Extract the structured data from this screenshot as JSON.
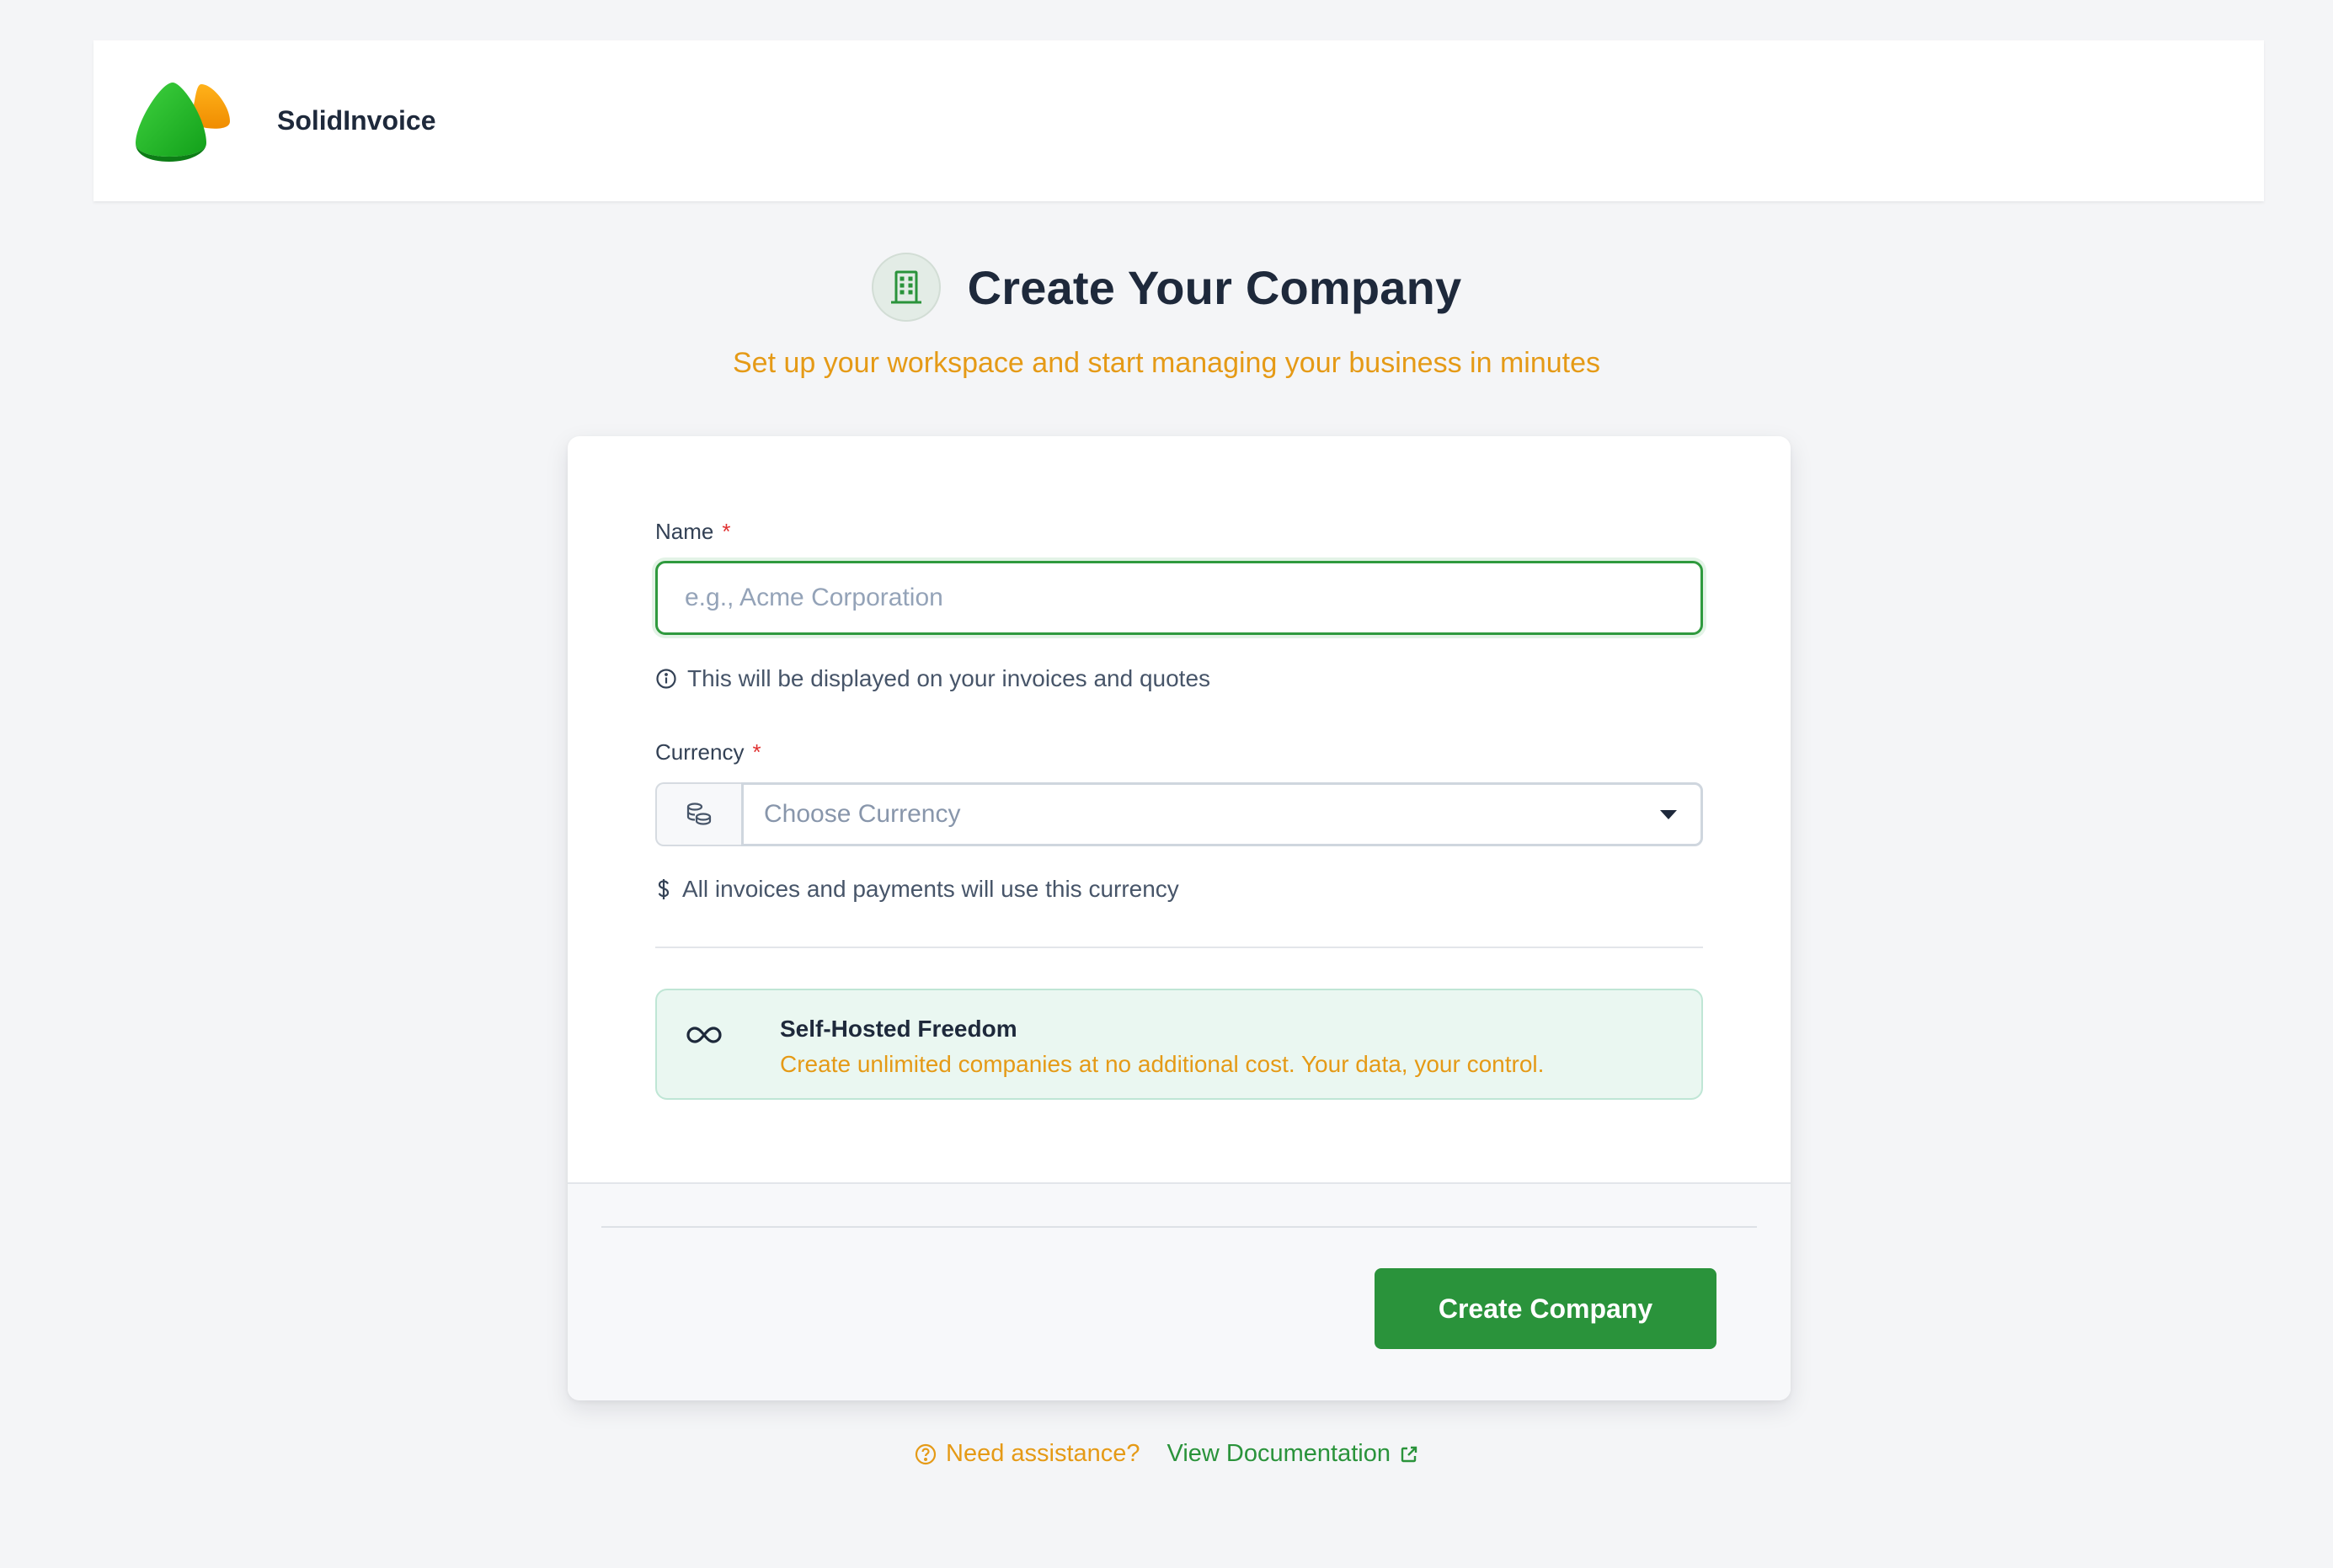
{
  "header": {
    "brand": "SolidInvoice",
    "logo_icon": "solidinvoice-logo"
  },
  "hero": {
    "icon": "building-icon",
    "title": "Create Your Company",
    "subtitle": "Set up your workspace and start managing your business in minutes"
  },
  "form": {
    "name_label": "Name",
    "required_mark": "*",
    "name_value": "",
    "name_placeholder": "e.g., Acme Corporation",
    "name_hint": "This will be displayed on your invoices and quotes",
    "currency_label": "Currency",
    "currency_placeholder": "Choose Currency",
    "currency_hint": "All invoices and payments will use this currency"
  },
  "info": {
    "icon": "infinity-icon",
    "title": "Self-Hosted Freedom",
    "text": "Create unlimited companies at no additional cost. Your data, your control."
  },
  "footer": {
    "submit_label": "Create Company"
  },
  "help": {
    "question": "Need assistance?",
    "link": "View Documentation"
  },
  "colors": {
    "accent_green": "#2a933b",
    "accent_orange": "#e59a16",
    "background": "#f4f5f7"
  }
}
